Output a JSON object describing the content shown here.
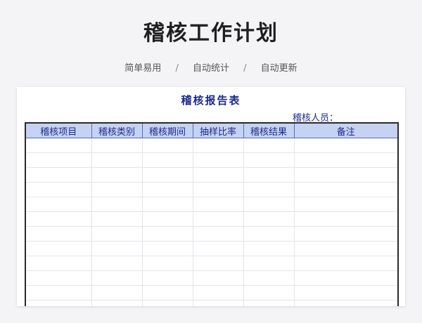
{
  "page": {
    "title": "稽核工作计划",
    "features": [
      "简单易用",
      "自动统计",
      "自动更新"
    ],
    "separator": "/"
  },
  "report": {
    "title": "稽核报告表",
    "auditor_label": "稽核人员：",
    "columns": [
      "稽核项目",
      "稽核类别",
      "稽核期间",
      "抽样比率",
      "稽核结果",
      "备注"
    ],
    "empty_rows": 12
  },
  "colors": {
    "header_fill": "#c5d2f2",
    "header_text": "#1a2a8c",
    "border": "#2a2a2a"
  }
}
